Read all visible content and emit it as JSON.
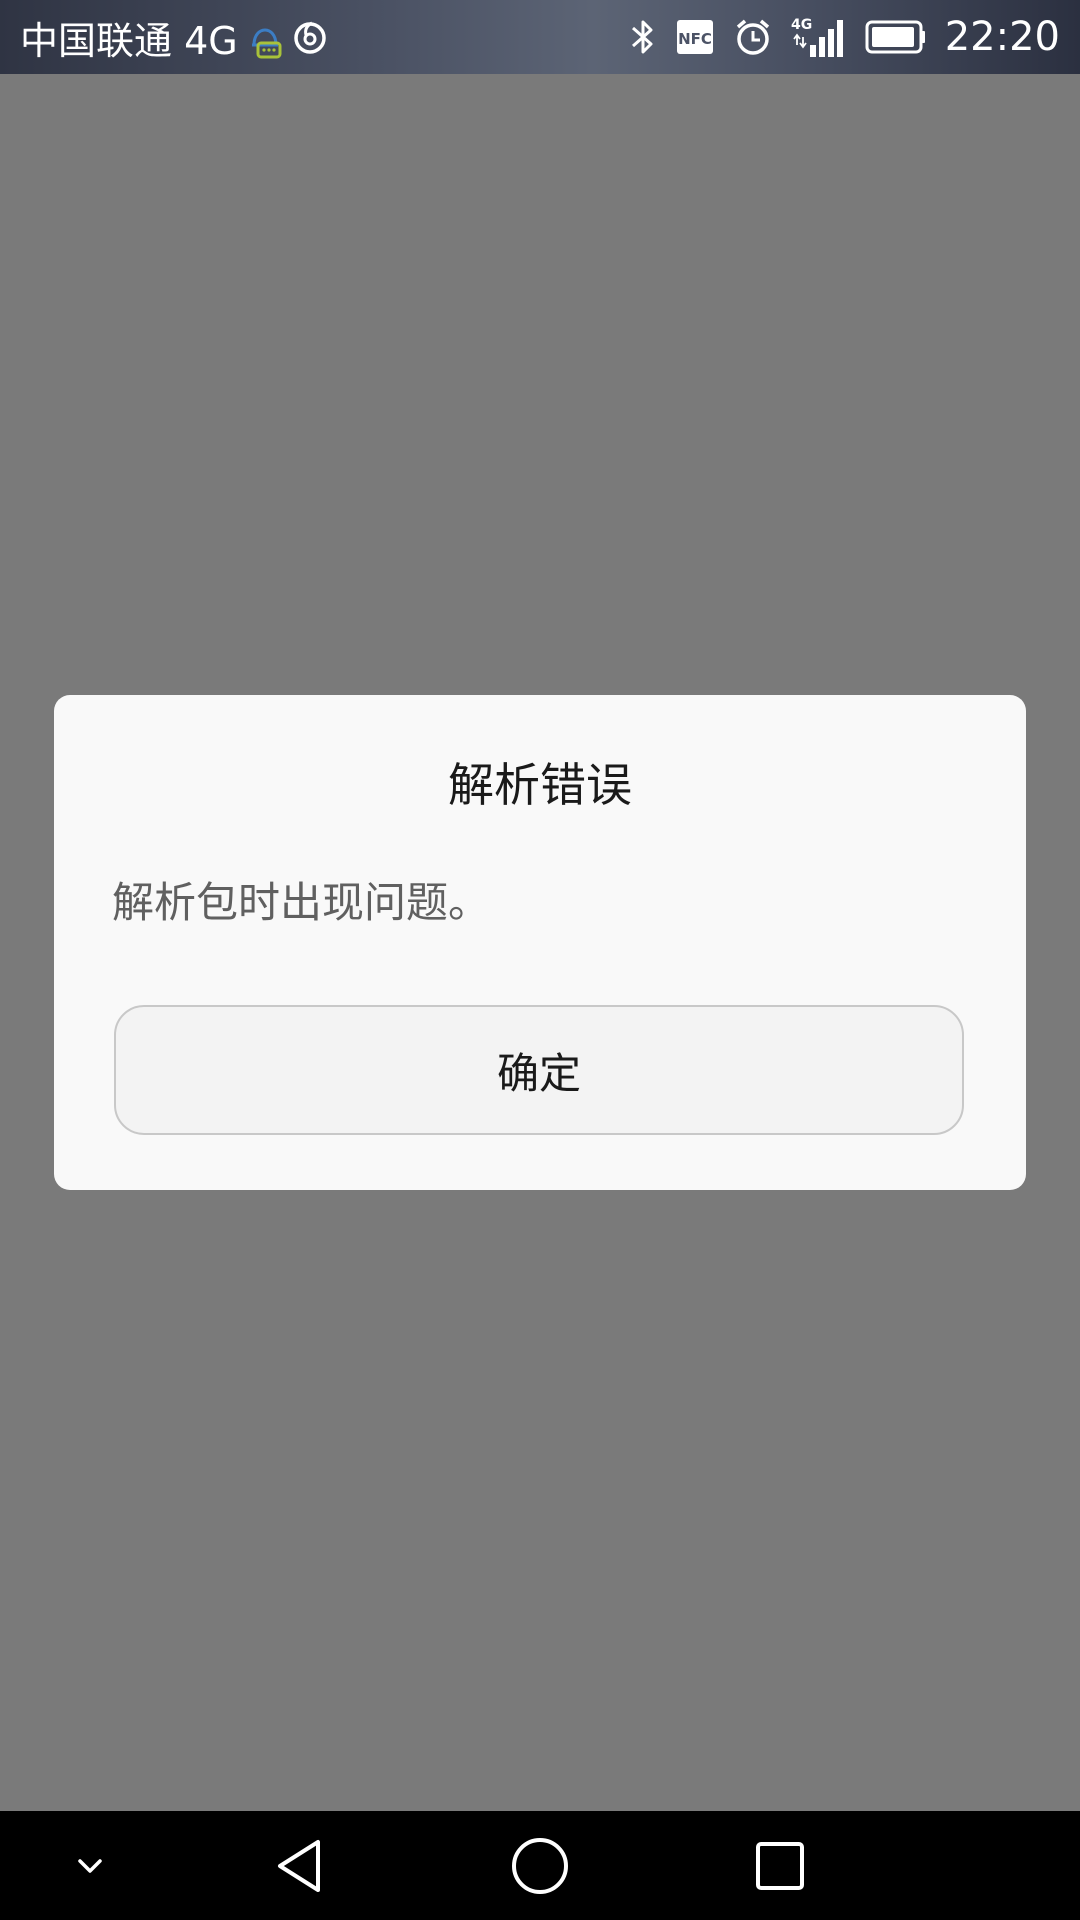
{
  "status_bar": {
    "carrier": "中国联通 4G",
    "nfc_label": "NFC",
    "signal_label": "4G",
    "time": "22:20",
    "icons": [
      "chat-notification-icon",
      "netease-music-icon",
      "bluetooth-icon",
      "nfc-icon",
      "alarm-icon",
      "signal-icon",
      "battery-icon"
    ]
  },
  "dialog": {
    "title": "解析错误",
    "message": "解析包时出现问题。",
    "ok_label": "确定"
  },
  "nav_bar": {
    "icons": [
      "collapse-chevron-icon",
      "back-icon",
      "home-icon",
      "recents-icon"
    ]
  },
  "colors": {
    "scrim": "#7a7a7a",
    "dialog_bg": "#f9f9f9",
    "nav_bg": "#000000",
    "accent_chat": "#3c7dc4",
    "accent_chat_badge": "#a8c23a"
  }
}
